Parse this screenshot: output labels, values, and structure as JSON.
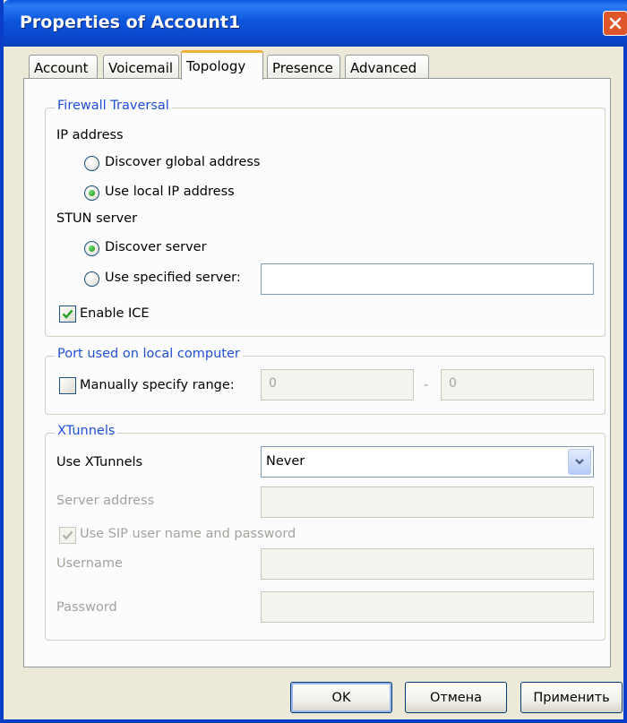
{
  "window": {
    "title": "Properties of Account1",
    "close_icon": "close-icon"
  },
  "tabs": [
    {
      "label": "Account",
      "active": false
    },
    {
      "label": "Voicemail",
      "active": false
    },
    {
      "label": "Topology",
      "active": true
    },
    {
      "label": "Presence",
      "active": false
    },
    {
      "label": "Advanced",
      "active": false
    }
  ],
  "firewall": {
    "legend": "Firewall Traversal",
    "ip_address_label": "IP address",
    "ip_options": [
      {
        "label": "Discover global address",
        "selected": false
      },
      {
        "label": "Use local IP address",
        "selected": true
      }
    ],
    "stun_label": "STUN server",
    "stun_options": [
      {
        "label": "Discover server",
        "selected": true
      },
      {
        "label": "Use specified server:",
        "selected": false
      }
    ],
    "stun_server_value": "",
    "enable_ice_label": "Enable ICE",
    "enable_ice_checked": true
  },
  "port": {
    "legend": "Port used on local computer",
    "manual_label": "Manually specify range:",
    "manual_checked": false,
    "range_from": "0",
    "range_separator": "-",
    "range_to": "0"
  },
  "xtunnels": {
    "legend": "XTunnels",
    "use_label": "Use XTunnels",
    "use_value": "Never",
    "server_address_label": "Server address",
    "use_sip_label": "Use SIP user name and password",
    "use_sip_checked": true,
    "username_label": "Username",
    "password_label": "Password"
  },
  "buttons": {
    "ok": "OK",
    "cancel": "Отмена",
    "apply": "Применить"
  },
  "colors": {
    "titlebar": "#0a4fd6",
    "legend_text": "#1e4fd6",
    "active_tab_accent": "#f1b036",
    "close_button": "#e0562b"
  }
}
